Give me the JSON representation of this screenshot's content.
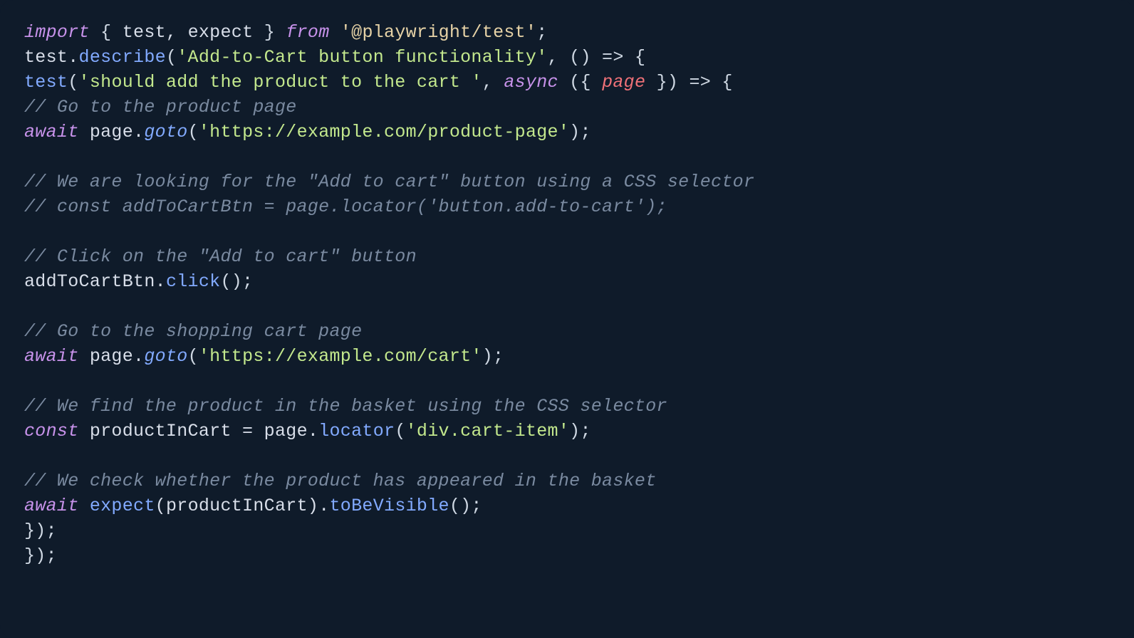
{
  "code": {
    "line1": {
      "kw_import": "import",
      "brace_open": " { ",
      "ids": "test, expect",
      "brace_close": " } ",
      "kw_from": "from",
      "sp": " ",
      "str": "'@playwright/test'",
      "semi": ";"
    },
    "line2": {
      "ids": "test.",
      "fn": "describe",
      "open": "(",
      "str": "'Add-to-Cart button functionality'",
      "rest": ", () => {"
    },
    "line3": {
      "fn": "test",
      "open": "(",
      "str": "'should add the product to the cart '",
      "comma": ", ",
      "kw_async": "async",
      "sp": " ({ ",
      "param": "page",
      "rest": " }) => {"
    },
    "line4": {
      "comment": "// Go to the product page"
    },
    "line5": {
      "kw_await": "await",
      "sp": " ",
      "id": "page.",
      "fn": "goto",
      "open": "(",
      "str": "'https://example.com/product-page'",
      "close": ");"
    },
    "line6": {
      "blank": " "
    },
    "line7": {
      "comment": "// We are looking for the \"Add to cart\" button using a CSS selector"
    },
    "line8": {
      "comment": "// const addToCartBtn = page.locator('button.add-to-cart');"
    },
    "line9": {
      "blank": " "
    },
    "line10": {
      "comment": "// Click on the \"Add to cart\" button"
    },
    "line11": {
      "id": "addToCartBtn.",
      "fn": "click",
      "rest": "();"
    },
    "line12": {
      "blank": " "
    },
    "line13": {
      "comment": "// Go to the shopping cart page"
    },
    "line14": {
      "kw_await": "await",
      "sp": " ",
      "id": "page.",
      "fn": "goto",
      "open": "(",
      "str": "'https://example.com/cart'",
      "close": ");"
    },
    "line15": {
      "blank": " "
    },
    "line16": {
      "comment": "// We find the product in the basket using the CSS selector"
    },
    "line17": {
      "kw_const": "const",
      "sp": " ",
      "id1": "productInCart = page.",
      "fn": "locator",
      "open": "(",
      "str": "'div.cart-item'",
      "close": ");"
    },
    "line18": {
      "blank": " "
    },
    "line19": {
      "comment": "// We check whether the product has appeared in the basket"
    },
    "line20": {
      "kw_await": "await",
      "sp": " ",
      "fn1": "expect",
      "mid": "(productInCart).",
      "fn2": "toBeVisible",
      "rest": "();"
    },
    "line21": {
      "text": "});"
    },
    "line22": {
      "text": "});"
    }
  }
}
